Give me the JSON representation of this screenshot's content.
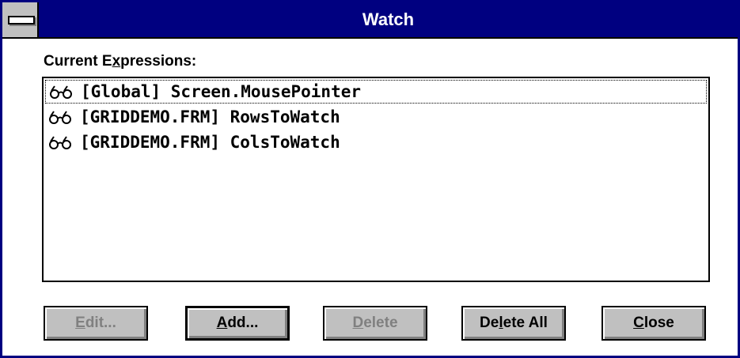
{
  "window": {
    "title": "Watch"
  },
  "expressions": {
    "label_prefix": "Current E",
    "label_mnemonic": "x",
    "label_suffix": "pressions:",
    "items": [
      {
        "icon": "eyeglasses-icon",
        "text": "[Global] Screen.MousePointer"
      },
      {
        "icon": "eyeglasses-icon",
        "text": "[GRIDDEMO.FRM] RowsToWatch"
      },
      {
        "icon": "eyeglasses-icon",
        "text": "[GRIDDEMO.FRM] ColsToWatch"
      }
    ]
  },
  "buttons": {
    "edit": {
      "mnemonic": "E",
      "rest": "dit...",
      "enabled": false
    },
    "add": {
      "mnemonic": "A",
      "rest": "dd...",
      "enabled": true
    },
    "delete": {
      "mnemonic": "D",
      "rest": "elete",
      "enabled": false
    },
    "delete_all": {
      "pre": "De",
      "mnemonic": "l",
      "rest": "ete All",
      "enabled": true
    },
    "close": {
      "mnemonic": "C",
      "rest": "lose",
      "enabled": true
    }
  },
  "colors": {
    "title_bar": "#000080",
    "button_face": "#c0c0c0",
    "disabled_text": "#808080"
  }
}
